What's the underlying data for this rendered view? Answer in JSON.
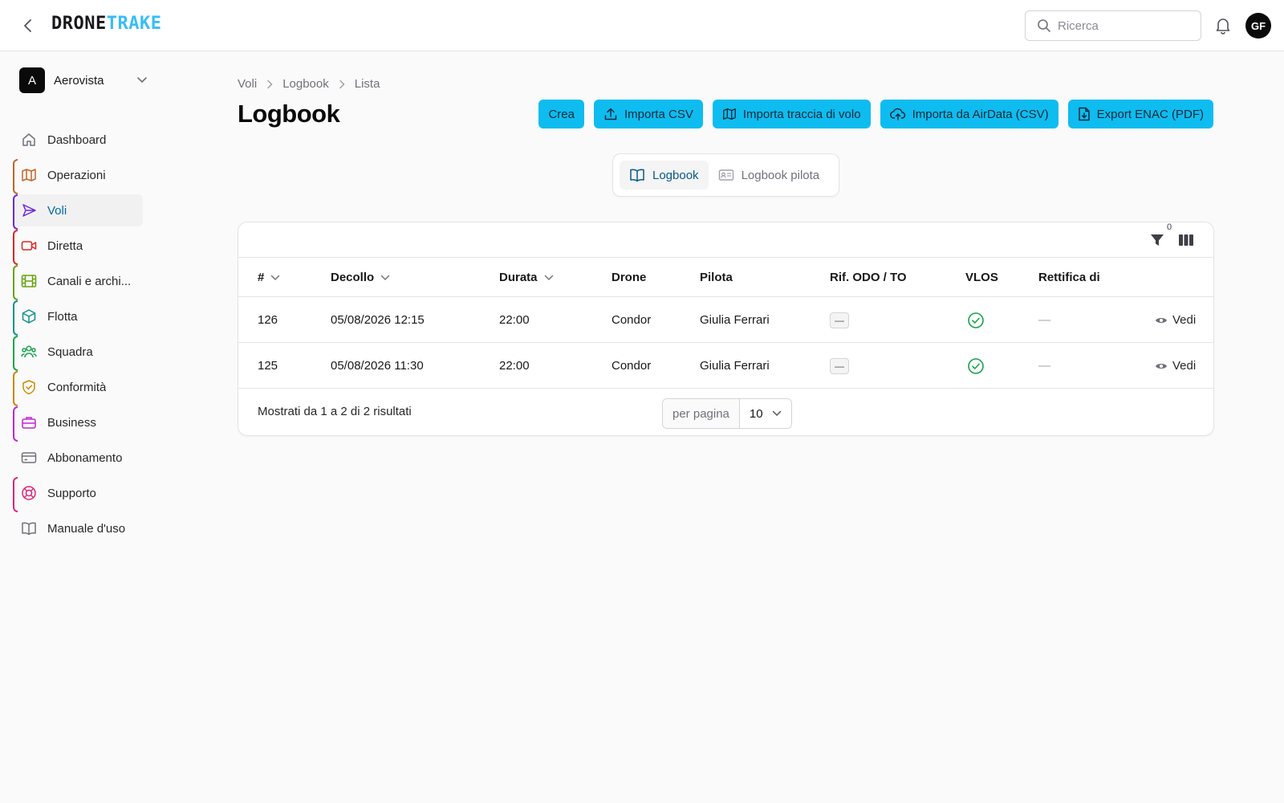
{
  "header": {
    "logo_part1": "DRONE",
    "logo_part2": "TRAKE",
    "search_placeholder": "Ricerca",
    "user_initials": "GF"
  },
  "organization": {
    "badge": "A",
    "name": "Aerovista"
  },
  "sidebar": {
    "items": [
      {
        "label": "Dashboard",
        "icon": "home-icon",
        "accent": ""
      },
      {
        "label": "Operazioni",
        "icon": "map-icon",
        "accent": "#c2652a"
      },
      {
        "label": "Voli",
        "icon": "send-icon",
        "accent": "#6d28d9",
        "active": true
      },
      {
        "label": "Diretta",
        "icon": "video-icon",
        "accent": "#dc2626"
      },
      {
        "label": "Canali e archi...",
        "icon": "film-icon",
        "accent": "#65a30d"
      },
      {
        "label": "Flotta",
        "icon": "box-icon",
        "accent": "#0d9488"
      },
      {
        "label": "Squadra",
        "icon": "users-icon",
        "accent": "#16a34a"
      },
      {
        "label": "Conformità",
        "icon": "shield-icon",
        "accent": "#ca8a04"
      },
      {
        "label": "Business",
        "icon": "briefcase-icon",
        "accent": "#c026d3"
      },
      {
        "label": "Abbonamento",
        "icon": "credit-card-icon",
        "accent": ""
      },
      {
        "label": "Supporto",
        "icon": "life-buoy-icon",
        "accent": "#db2777"
      },
      {
        "label": "Manuale d'uso",
        "icon": "book-icon",
        "accent": ""
      }
    ]
  },
  "breadcrumb": [
    "Voli",
    "Logbook",
    "Lista"
  ],
  "page_title": "Logbook",
  "actions": {
    "create": "Crea",
    "import_csv": "Importa CSV",
    "import_track": "Importa traccia di volo",
    "import_airdata": "Importa da AirData (CSV)",
    "export_enac": "Export ENAC (PDF)"
  },
  "tabs": [
    {
      "label": "Logbook",
      "icon": "book-open-icon",
      "active": true
    },
    {
      "label": "Logbook pilota",
      "icon": "id-card-icon",
      "active": false
    }
  ],
  "table": {
    "filter_count": "0",
    "columns": [
      "#",
      "Decollo",
      "Durata",
      "Drone",
      "Pilota",
      "Rif. ODO / TO",
      "VLOS",
      "Rettifica di"
    ],
    "rows": [
      {
        "id": "126",
        "takeoff": "05/08/2026 12:15",
        "duration": "22:00",
        "drone": "Condor",
        "pilot": "Giulia Ferrari",
        "ref": "—",
        "vlos": "check-circle-icon",
        "rectify": "—",
        "action": "Vedi"
      },
      {
        "id": "125",
        "takeoff": "05/08/2026 11:30",
        "duration": "22:00",
        "drone": "Condor",
        "pilot": "Giulia Ferrari",
        "ref": "—",
        "vlos": "check-circle-icon",
        "rectify": "—",
        "action": "Vedi"
      }
    ],
    "summary": "Mostrati da 1 a 2 di 2 risultati",
    "per_page_label": "per pagina",
    "per_page_value": "10"
  },
  "colors": {
    "accent_button": "#0ebcf0",
    "logo_accent": "#38bdf8",
    "active_nav_text": "#0369a1",
    "vlos_ok": "#16a34a"
  }
}
